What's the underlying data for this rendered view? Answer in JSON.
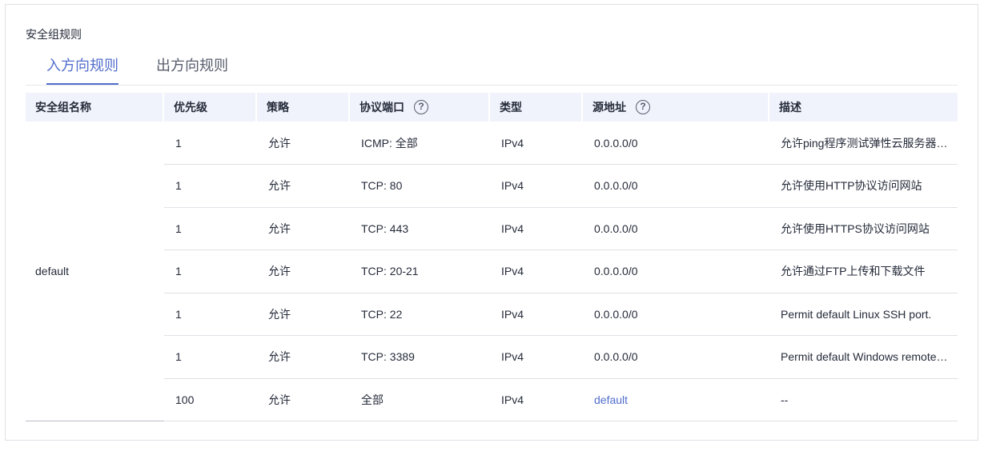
{
  "section_title": "安全组规则",
  "tabs": [
    {
      "label": "入方向规则",
      "active": true
    },
    {
      "label": "出方向规则",
      "active": false
    }
  ],
  "columns": [
    {
      "label": "安全组名称",
      "help": false
    },
    {
      "label": "优先级",
      "help": false
    },
    {
      "label": "策略",
      "help": false
    },
    {
      "label": "协议端口",
      "help": true
    },
    {
      "label": "类型",
      "help": false
    },
    {
      "label": "源地址",
      "help": true
    },
    {
      "label": "描述",
      "help": false
    }
  ],
  "help_glyph": "?",
  "group_name": "default",
  "rules": [
    {
      "priority": "1",
      "action": "允许",
      "protocol_port": "ICMP: 全部",
      "type": "IPv4",
      "source": "0.0.0.0/0",
      "source_is_link": false,
      "description": "允许ping程序测试弹性云服务器的连通性"
    },
    {
      "priority": "1",
      "action": "允许",
      "protocol_port": "TCP: 80",
      "type": "IPv4",
      "source": "0.0.0.0/0",
      "source_is_link": false,
      "description": "允许使用HTTP协议访问网站"
    },
    {
      "priority": "1",
      "action": "允许",
      "protocol_port": "TCP: 443",
      "type": "IPv4",
      "source": "0.0.0.0/0",
      "source_is_link": false,
      "description": "允许使用HTTPS协议访问网站"
    },
    {
      "priority": "1",
      "action": "允许",
      "protocol_port": "TCP: 20-21",
      "type": "IPv4",
      "source": "0.0.0.0/0",
      "source_is_link": false,
      "description": "允许通过FTP上传和下载文件"
    },
    {
      "priority": "1",
      "action": "允许",
      "protocol_port": "TCP: 22",
      "type": "IPv4",
      "source": "0.0.0.0/0",
      "source_is_link": false,
      "description": "Permit default Linux SSH port."
    },
    {
      "priority": "1",
      "action": "允许",
      "protocol_port": "TCP: 3389",
      "type": "IPv4",
      "source": "0.0.0.0/0",
      "source_is_link": false,
      "description": "Permit default Windows remote desktop port."
    },
    {
      "priority": "100",
      "action": "允许",
      "protocol_port": "全部",
      "type": "IPv4",
      "source": "default",
      "source_is_link": true,
      "description": "--"
    }
  ],
  "colors": {
    "accent": "#526ecc",
    "header_bg": "#f0f3fb",
    "border": "#dfe1e6"
  }
}
